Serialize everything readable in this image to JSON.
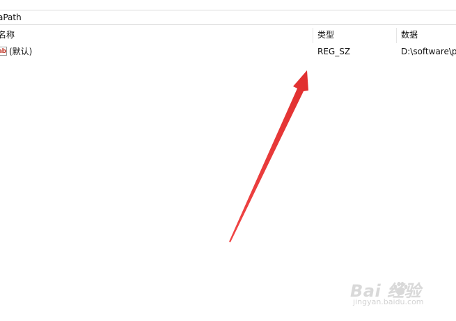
{
  "address_bar": {
    "path_text": "aPath"
  },
  "columns": {
    "name": "名称",
    "type": "类型",
    "data": "数据"
  },
  "rows": [
    {
      "icon": "string-value-icon",
      "icon_text": "ab",
      "name": "(默认)",
      "type": "REG_SZ",
      "data": "D:\\software\\p"
    }
  ],
  "annotation": {
    "arrow_color": "#ee3a3a"
  },
  "watermark": {
    "logo_text": "Bai  经验",
    "sub_text": "jingyan.baidu.com"
  }
}
